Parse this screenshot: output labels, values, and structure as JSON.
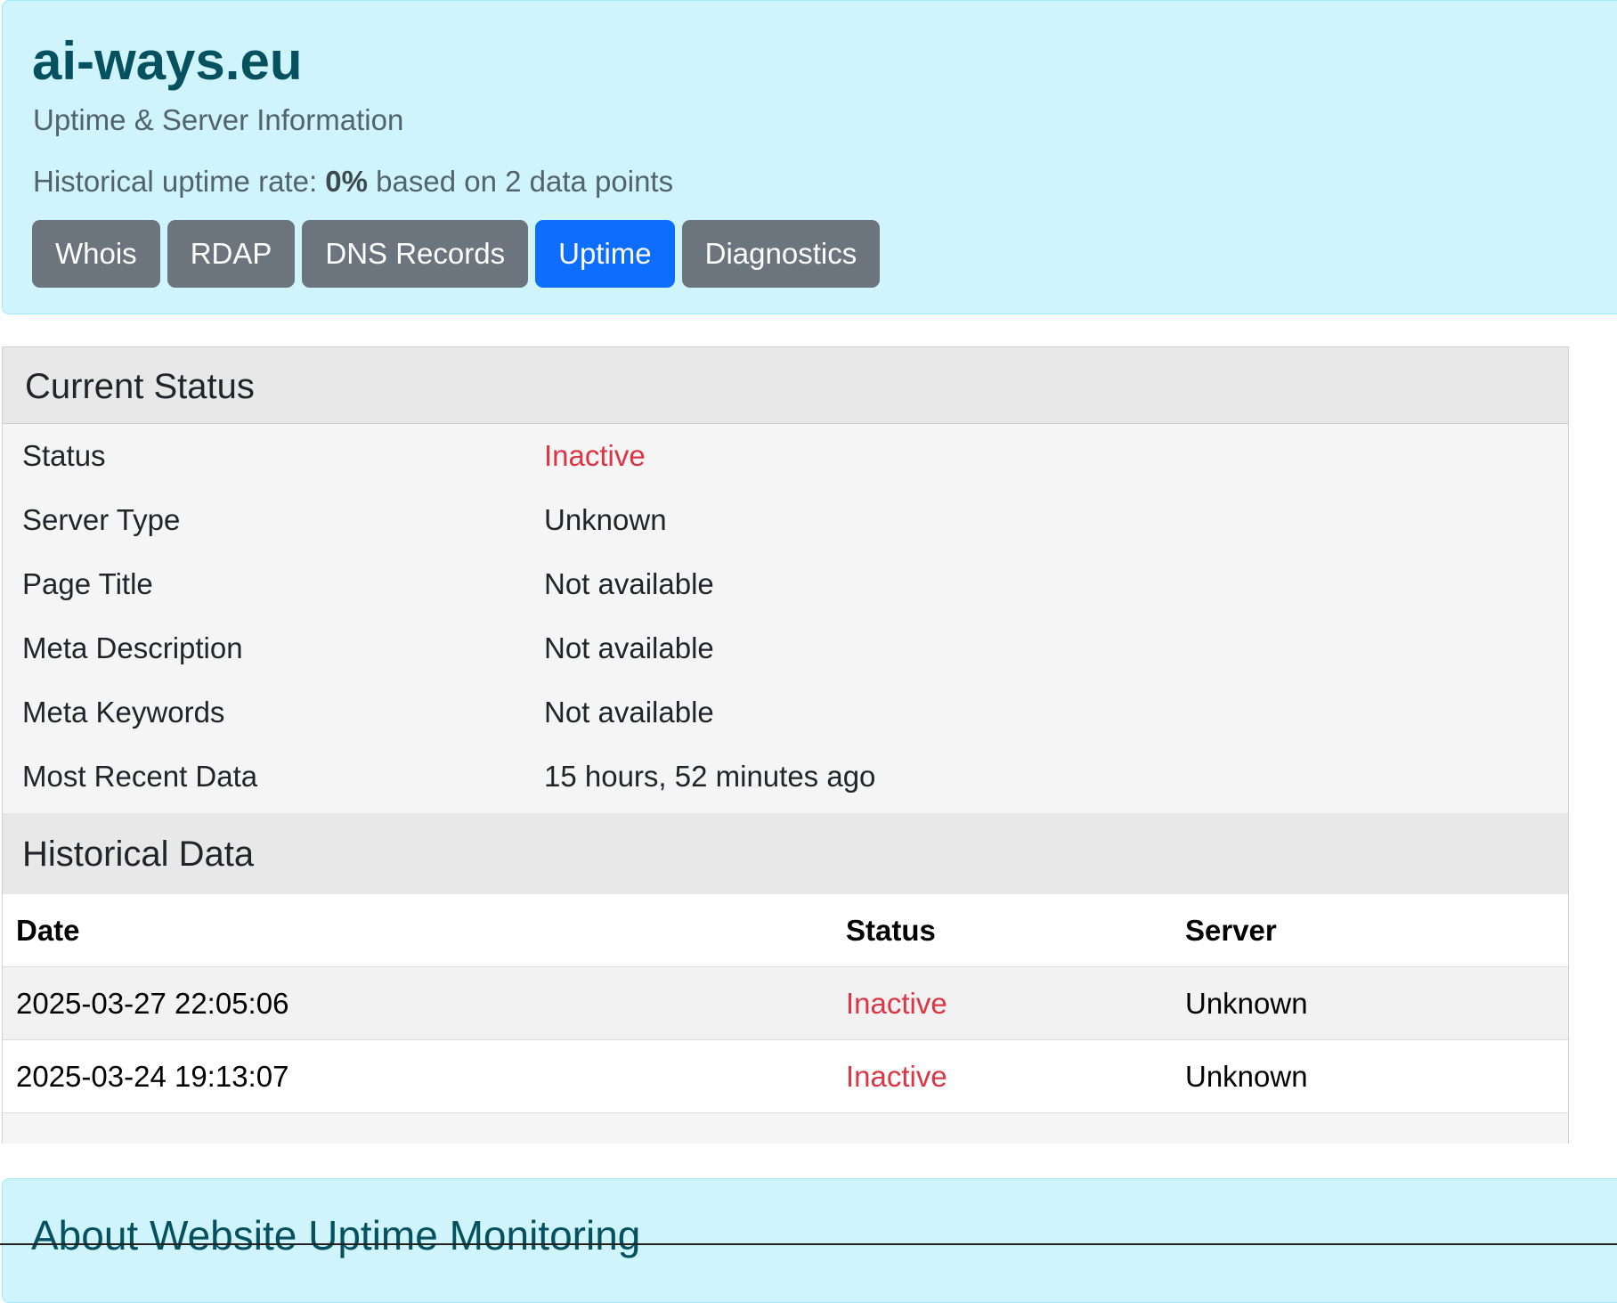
{
  "header": {
    "domain": "ai-ways.eu",
    "subtitle": "Uptime & Server Information",
    "uptime_prefix": "Historical uptime rate: ",
    "uptime_rate": "0%",
    "uptime_suffix": " based on 2 data points"
  },
  "tabs": [
    {
      "label": "Whois",
      "active": false
    },
    {
      "label": "RDAP",
      "active": false
    },
    {
      "label": "DNS Records",
      "active": false
    },
    {
      "label": "Uptime",
      "active": true
    },
    {
      "label": "Diagnostics",
      "active": false
    }
  ],
  "current_status": {
    "title": "Current Status",
    "rows": [
      {
        "label": "Status",
        "value": "Inactive"
      },
      {
        "label": "Server Type",
        "value": "Unknown"
      },
      {
        "label": "Page Title",
        "value": "Not available"
      },
      {
        "label": "Meta Description",
        "value": "Not available"
      },
      {
        "label": "Meta Keywords",
        "value": "Not available"
      },
      {
        "label": "Most Recent Data",
        "value": "15 hours, 52 minutes ago"
      }
    ]
  },
  "historical": {
    "title": "Historical Data",
    "columns": [
      "Date",
      "Status",
      "Server"
    ],
    "rows": [
      {
        "date": "2025-03-27 22:05:06",
        "status": "Inactive",
        "server": "Unknown"
      },
      {
        "date": "2025-03-24 19:13:07",
        "status": "Inactive",
        "server": "Unknown"
      }
    ]
  },
  "about": {
    "title": "About Website Uptime Monitoring"
  },
  "colors": {
    "info_bg": "#cff4fc",
    "info_text": "#055160",
    "button_secondary": "#6c757d",
    "button_primary": "#0d6efd",
    "danger": "#dc3545"
  }
}
